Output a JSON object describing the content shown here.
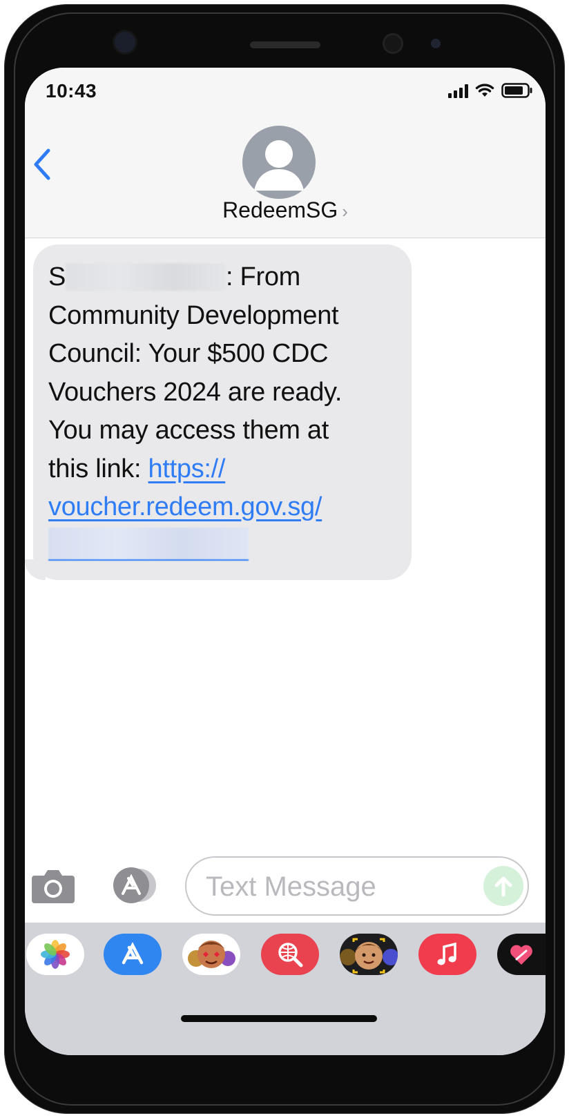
{
  "status_bar": {
    "time": "10:43"
  },
  "header": {
    "back_label": "Back",
    "contact_name": "RedeemSG",
    "chevron": "›"
  },
  "message": {
    "sender_prefix": "S",
    "line_a": ": From",
    "line_b": "Community Development",
    "line_c": "Council: Your $500 CDC",
    "line_d": "Vouchers 2024 are ready.",
    "line_e": "You may access them at",
    "line_f": "this link: ",
    "link_a": "https://",
    "link_b": "voucher.redeem.gov.sg/"
  },
  "input": {
    "placeholder": "Text Message"
  },
  "app_drawer": {
    "apps": [
      "photos-icon",
      "app-store-icon",
      "memoji-stickers-icon",
      "web-search-icon",
      "memoji-icon",
      "music-icon",
      "digital-touch-icon"
    ]
  },
  "colors": {
    "link": "#2e7cf6",
    "bubble": "#e9e9eb",
    "accent_blue": "#2f7bf5",
    "send_disabled": "#d6f1d9"
  }
}
